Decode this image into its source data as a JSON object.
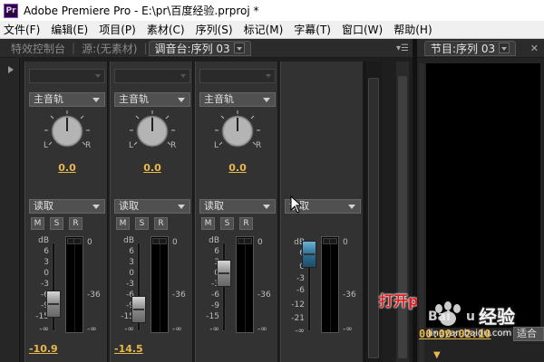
{
  "window": {
    "app_icon_label": "Pr",
    "title": "Adobe Premiere Pro - E:\\pr\\百度经验.prproj *"
  },
  "menu": [
    "文件(F)",
    "编辑(E)",
    "项目(P)",
    "素材(C)",
    "序列(S)",
    "标记(M)",
    "字幕(T)",
    "窗口(W)",
    "帮助(H)"
  ],
  "left_tabs": {
    "effect_controls": "特效控制台",
    "source": "源:(无素材)",
    "mixer": "调音台:序列 03"
  },
  "right_tabs": {
    "program": "节目:序列 03"
  },
  "mixer": {
    "channels": [
      {
        "track_dropdown": "主音轨",
        "pan_value": "0.0",
        "mode": "读取",
        "m": "M",
        "s": "S",
        "r": "R",
        "volume_value": "-10.9",
        "fader_level_db": -10.9
      },
      {
        "track_dropdown": "主音轨",
        "pan_value": "0.0",
        "mode": "读取",
        "m": "M",
        "s": "S",
        "r": "R",
        "volume_value": "-14.5",
        "fader_level_db": -14.5
      },
      {
        "track_dropdown": "主音轨",
        "pan_value": "0.0",
        "mode": "读取",
        "m": "M",
        "s": "S",
        "r": "R",
        "volume_value": "",
        "fader_level_db": -3
      },
      {
        "mode": "读取",
        "volume_value": "",
        "fader_level_db": 0
      }
    ],
    "knob_left_label": "L",
    "knob_right_label": "R",
    "fader_scale": [
      "dB",
      "6",
      "3",
      "0",
      "-3",
      "-6",
      "-9",
      "-15",
      "-∞"
    ],
    "master_fader_scale": [
      "dB",
      "6",
      "0",
      "-3",
      "-6",
      "-12",
      "-21",
      "-∞"
    ],
    "meter_scale": [
      "0",
      "-36",
      "-∞"
    ]
  },
  "annotation": "打开pr软件",
  "monitor": {
    "timecode": "00:00:02:10",
    "fit_label": "适合"
  },
  "watermark": {
    "brand": "经验",
    "url": "jingyan.baidu.com"
  },
  "colors": {
    "value_text": "#e8b84a",
    "annotation": "#e02020",
    "panel_bg": "#323232"
  }
}
